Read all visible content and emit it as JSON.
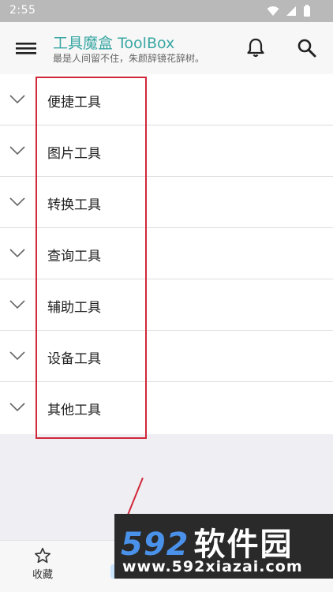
{
  "status_bar": {
    "time": "2:55"
  },
  "app_bar": {
    "title": "工具魔盒 ToolBox",
    "subtitle": "最是人间留不住，朱颜辞镜花辞树。",
    "accent_color": "#39a7a3"
  },
  "categories": [
    {
      "label": "便捷工具"
    },
    {
      "label": "图片工具"
    },
    {
      "label": "转换工具"
    },
    {
      "label": "查询工具"
    },
    {
      "label": "辅助工具"
    },
    {
      "label": "设备工具"
    },
    {
      "label": "其他工具"
    }
  ],
  "bottom_nav": {
    "items": [
      {
        "label": "收藏",
        "icon": "star-outline-icon"
      }
    ]
  },
  "watermark": {
    "brand_digits": "592",
    "brand_text": "软件园",
    "url": "www.592xiazai.com"
  },
  "annotation_color": "#d0283a"
}
